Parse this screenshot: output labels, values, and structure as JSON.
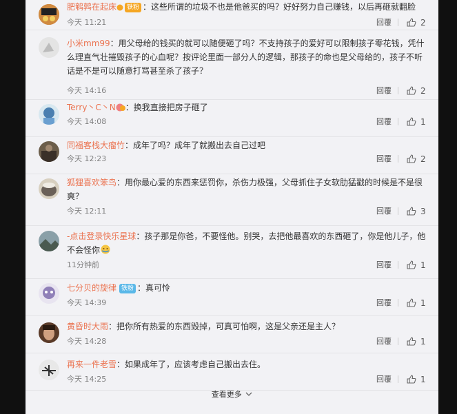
{
  "comments": [
    {
      "user": "肥鹌鹑在起床",
      "badge": "铁粉",
      "text": "：这些所谓的垃圾不也是他爸买的吗？好好努力自己赚钱，以后再砸就翻脸",
      "time": "今天 11:21",
      "reply": "回覆",
      "likes": "2"
    },
    {
      "user": "小米mm99",
      "badge": "",
      "text": "：用父母给的钱买的就可以随便砸了吗？不支持孩子的爱好可以限制孩子零花钱，凭什么理直气壮摧毁孩子的心血呢？按评论里面一部分人的逻辑，那孩子的命也是父母给的，孩子不听话是不是可以随意打骂甚至杀了孩子？",
      "time": "今天 14:16",
      "reply": "回覆",
      "likes": "2"
    },
    {
      "user": "Terry丶C丶N",
      "badge": "",
      "text": "：换我直接把房子砸了",
      "time": "今天 14:08",
      "reply": "回覆",
      "likes": "1"
    },
    {
      "user": "同福客栈大瘤竹",
      "badge": "",
      "text": "：成年了吗？成年了就搬出去自己过吧",
      "time": "今天 12:23",
      "reply": "回覆",
      "likes": "2"
    },
    {
      "user": "狐狸喜欢笨鸟",
      "badge": "",
      "text": "：用你最心爱的东西来惩罚你，杀伤力极强，父母抓住子女软肋猛戳的时候是不是很爽？",
      "time": "今天 12:11",
      "reply": "回覆",
      "likes": "3"
    },
    {
      "user": "-点击登录快乐星球",
      "badge": "",
      "text": "：孩子那是你爸，不要怪他。别哭，去把他最喜欢的东西砸了，你是他儿子，他不会怪你",
      "time": "11分钟前",
      "reply": "回覆",
      "likes": "1"
    },
    {
      "user": "七分贝的旋律",
      "badge": "铁粉",
      "text": "：真可怜",
      "time": "今天 14:39",
      "reply": "回覆",
      "likes": "1"
    },
    {
      "user": "黄昏时大雨",
      "badge": "",
      "text": "：把你所有热爱的东西毁掉，可真可怕啊，这是父亲还是主人？",
      "time": "今天 14:28",
      "reply": "回覆",
      "likes": "1"
    },
    {
      "user": "再来一件老雪",
      "badge": "",
      "text": "：如果成年了，应该考虑自己搬出去住。",
      "time": "今天 14:25",
      "reply": "回覆",
      "likes": "1"
    }
  ],
  "more_label": "查看更多",
  "colors": {
    "username": "#eb7350",
    "panel": "#f2f2f5",
    "page": "#101010"
  }
}
